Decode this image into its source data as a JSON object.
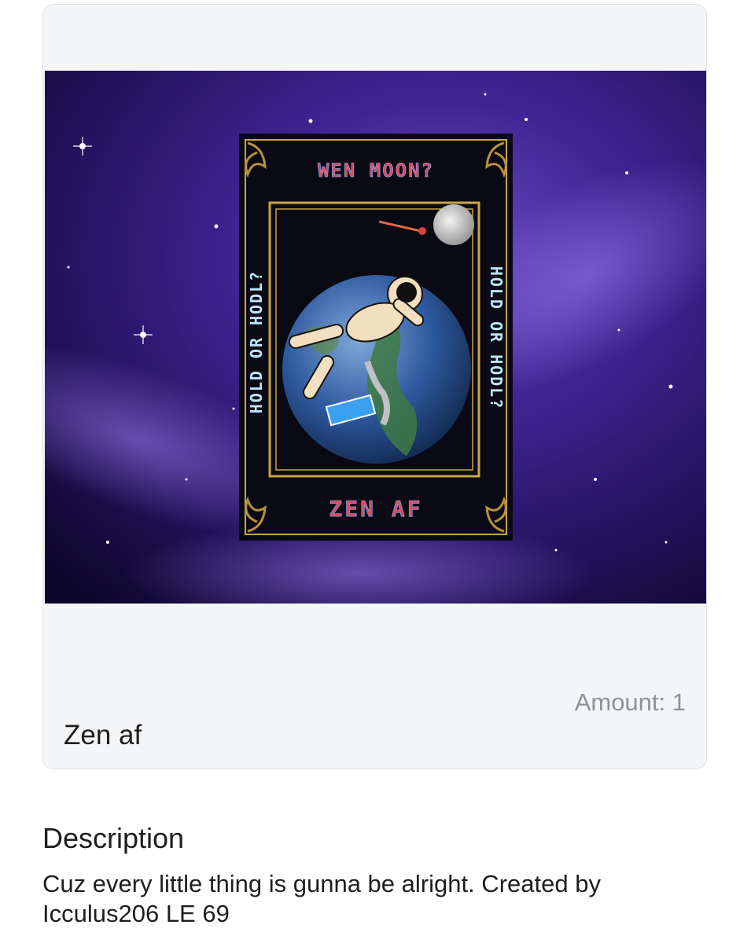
{
  "nft": {
    "title": "Zen af",
    "amount_text": "Amount: 1",
    "artwork": {
      "top_banner": "WEN MOON?",
      "bottom_banner": "ZEN AF",
      "side_text_left": "HOLD OR HODL?",
      "side_text_right": "HOLD OR HODL?"
    }
  },
  "description": {
    "heading": "Description",
    "body": "Cuz every little thing is gunna be alright. Created by Icculus206 LE 69"
  },
  "colors": {
    "card_bg": "#f4f5f7",
    "card_border": "#dfe1e5",
    "muted_text": "#8d929b",
    "space_dark": "#140a3a",
    "space_purple": "#5b3aa8",
    "gold_frame": "#c9a544",
    "banner_text": "#e0485f",
    "side_text": "#bfe6ff"
  }
}
